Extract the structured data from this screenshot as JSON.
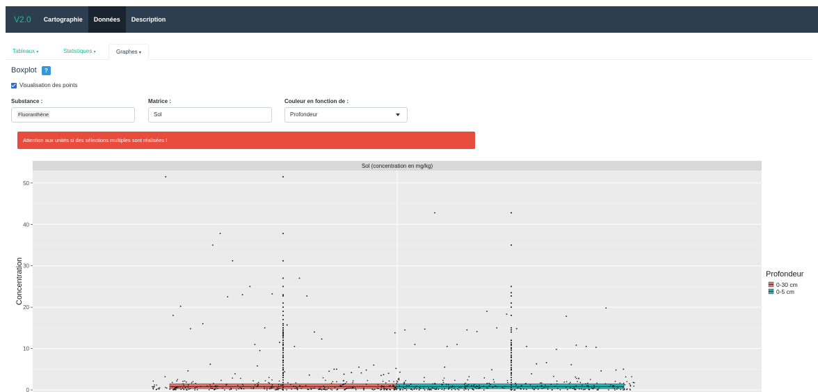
{
  "navbar": {
    "brand": "V2.0",
    "items": [
      {
        "label": "Cartographie",
        "active": false
      },
      {
        "label": "Données",
        "active": true
      },
      {
        "label": "Description",
        "active": false
      }
    ]
  },
  "tabs": [
    {
      "label": "Tableaux",
      "active": false
    },
    {
      "label": "Statistiques",
      "active": false
    },
    {
      "label": "Graphes",
      "active": true
    }
  ],
  "section_title": "Boxplot",
  "help_label": "?",
  "checkbox": {
    "label": "Visualisation des points",
    "checked": true
  },
  "fields": {
    "substance": {
      "label": "Substance :",
      "value": "Fluoranthène"
    },
    "matrice": {
      "label": "Matrice :",
      "value": "Sol"
    },
    "couleur": {
      "label": "Couleur en fonction de :",
      "value": "Profondeur"
    }
  },
  "alert": "Attention aux unités si des sélections multiples sont réalisées !",
  "colors": {
    "navbar": "#2c3e50",
    "accent": "#18bc9c",
    "alert": "#e74c3c",
    "series_0_30": "#e4736c",
    "series_0_5": "#23b4b4"
  },
  "chart_data": {
    "type": "boxplot",
    "facet_title": "Sol (concentration en mg/kg)",
    "ylabel": "Concentration",
    "xlabel": "",
    "ylim": [
      -0.5,
      53
    ],
    "yticks": [
      0,
      10,
      20,
      30,
      40,
      50
    ],
    "grid": true,
    "legend": {
      "title": "Profondeur",
      "position": "right",
      "entries": [
        "0-30 cm",
        "0-5 cm"
      ]
    },
    "series": [
      {
        "name": "0-30 cm",
        "color": "#e4736c",
        "box": {
          "q1": 0.3,
          "median": 0.8,
          "q3": 1.5,
          "whisker_low": 0.0,
          "whisker_high": 3.2
        },
        "points_x": [
          0.04,
          0.07,
          0.1,
          0.14,
          0.19,
          0.23,
          0.26,
          0.29,
          0.31,
          0.35,
          0.38,
          0.4,
          0.42,
          0.44,
          0.47,
          0.5,
          0.53,
          0.56,
          0.58,
          0.61,
          0.64,
          0.67,
          0.7,
          0.73,
          0.76,
          0.79,
          0.82,
          0.85,
          0.88,
          0.91,
          0.94,
          0.97,
          0.13,
          0.22,
          0.32,
          0.41,
          0.52,
          0.62,
          0.72,
          0.83,
          0.92
        ],
        "points_y": [
          51.5,
          18,
          20.2,
          14.8,
          16,
          35,
          37.8,
          22.5,
          31.2,
          23,
          25,
          11,
          9.5,
          15,
          23.2,
          11.5,
          15.7,
          10.5,
          27,
          22.7,
          14,
          12.3,
          4.5,
          5,
          3.8,
          4.2,
          5.5,
          4.8,
          6,
          3.5,
          4,
          5.2,
          4.6,
          6.2,
          3.9,
          5.8,
          4.4,
          3.6,
          5,
          4.1,
          3.7
        ]
      },
      {
        "name": "0-5 cm",
        "color": "#23b4b4",
        "box": {
          "q1": 0.3,
          "median": 0.8,
          "q3": 1.5,
          "whisker_low": 0.0,
          "whisker_high": 3.2
        },
        "points_x": [
          0.05,
          0.09,
          0.13,
          0.17,
          0.21,
          0.26,
          0.3,
          0.34,
          0.38,
          0.42,
          0.46,
          0.5,
          0.54,
          0.58,
          0.62,
          0.66,
          0.7,
          0.74,
          0.78,
          0.82,
          0.86,
          0.9,
          0.94,
          0.97,
          0.07,
          0.25,
          0.44,
          0.6,
          0.76,
          0.88
        ],
        "points_y": [
          13.8,
          14.5,
          11,
          14.7,
          42.8,
          10.5,
          11,
          14.5,
          14.1,
          19,
          15,
          18.3,
          14.8,
          10.5,
          6.3,
          6.6,
          9.8,
          17.8,
          10.8,
          10.5,
          10.3,
          19.8,
          4.8,
          5,
          4.3,
          5.5,
          4.9,
          3.9,
          6.1,
          4.6
        ]
      }
    ],
    "outliers_column": {
      "x_position": "center",
      "values": [
        51.5,
        37.8,
        31.2,
        27,
        25,
        23,
        22.7,
        21,
        20,
        19,
        18,
        17,
        16,
        15,
        14.5,
        14,
        13.5,
        13,
        12,
        11,
        10,
        9,
        8,
        7,
        6,
        5,
        4,
        3.5
      ]
    },
    "outliers_column_2": {
      "values": [
        42.8,
        35,
        25,
        23.5,
        22.7,
        21,
        20,
        18,
        15,
        14.5,
        14,
        12,
        11,
        10,
        9,
        8,
        7,
        6,
        5,
        4
      ]
    }
  }
}
